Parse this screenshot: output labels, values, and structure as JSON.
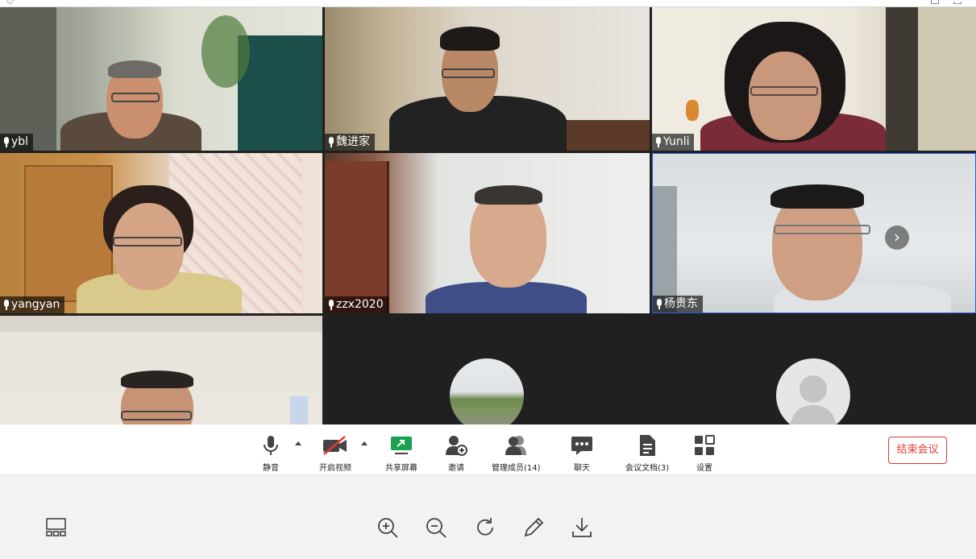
{
  "participants": [
    {
      "name": "ybl"
    },
    {
      "name": "魏进家"
    },
    {
      "name": "Yunli"
    },
    {
      "name": "yangyan"
    },
    {
      "name": "zzx2020"
    },
    {
      "name": "杨贵东"
    }
  ],
  "toolbar": {
    "mute": "静音",
    "video": "开启视频",
    "share": "共享屏幕",
    "invite": "邀请",
    "members": "管理成员(14)",
    "chat": "聊天",
    "docs": "会议文档(3)",
    "settings": "设置",
    "end": "结束会议"
  },
  "icons": {
    "next": "chevron-right-icon",
    "share_color": "#1aa152",
    "end_color": "#e4392d"
  }
}
